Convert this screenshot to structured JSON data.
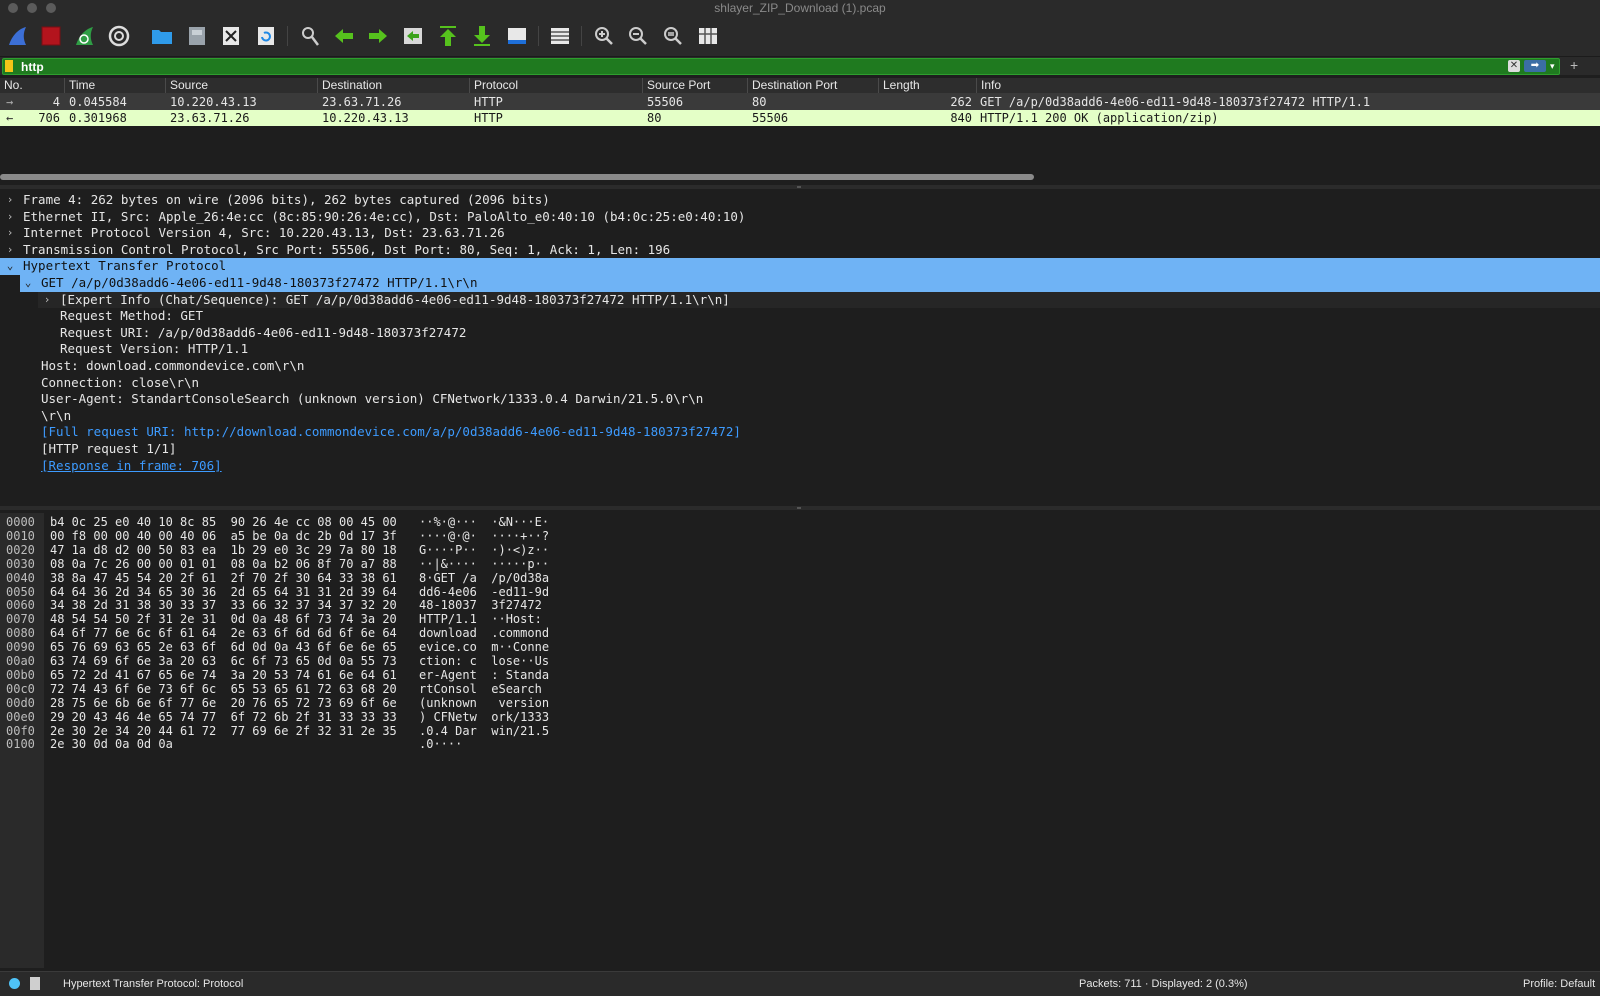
{
  "window": {
    "title": "shlayer_ZIP_Download (1).pcap"
  },
  "toolbar": {
    "buttons": [
      {
        "name": "start-capture",
        "icon": "shark-fin-icon"
      },
      {
        "name": "stop-capture",
        "icon": "stop-icon"
      },
      {
        "name": "restart-capture",
        "icon": "restart-fin-icon"
      },
      {
        "name": "capture-options",
        "icon": "gear-icon"
      },
      {
        "name": "open-file",
        "icon": "folder-icon"
      },
      {
        "name": "save-file",
        "icon": "save-icon"
      },
      {
        "name": "close-file",
        "icon": "close-file-icon"
      },
      {
        "name": "reload-file",
        "icon": "reload-icon"
      },
      {
        "name": "find-packet",
        "icon": "magnifier-icon"
      },
      {
        "name": "go-back",
        "icon": "arrow-left-icon"
      },
      {
        "name": "go-forward",
        "icon": "arrow-right-icon"
      },
      {
        "name": "go-to-packet",
        "icon": "go-to-icon"
      },
      {
        "name": "first-packet",
        "icon": "arrow-top-icon"
      },
      {
        "name": "last-packet",
        "icon": "arrow-bottom-icon"
      },
      {
        "name": "autoscroll",
        "icon": "autoscroll-icon"
      },
      {
        "name": "colorize",
        "icon": "colorize-icon"
      },
      {
        "name": "zoom-in",
        "icon": "zoom-in-icon"
      },
      {
        "name": "zoom-out",
        "icon": "zoom-out-icon"
      },
      {
        "name": "zoom-normal",
        "icon": "zoom-normal-icon"
      },
      {
        "name": "resize-columns",
        "icon": "resize-columns-icon"
      }
    ]
  },
  "filter": {
    "value": "http",
    "clear": "✕",
    "apply": "➡",
    "dropdown": "▾",
    "add": "+"
  },
  "packet_list": {
    "columns": [
      "No.",
      "Time",
      "Source",
      "Destination",
      "Protocol",
      "Source Port",
      "Destination Port",
      "Length",
      "Info"
    ],
    "rows": [
      {
        "marker": "→",
        "no": "4",
        "time": "0.045584",
        "source": "10.220.43.13",
        "destination": "23.63.71.26",
        "protocol": "HTTP",
        "src_port": "55506",
        "dst_port": "80",
        "length": "262",
        "info": "GET /a/p/0d38add6-4e06-ed11-9d48-180373f27472 HTTP/1.1"
      },
      {
        "marker": "←",
        "no": "706",
        "time": "0.301968",
        "source": "23.63.71.26",
        "destination": "10.220.43.13",
        "protocol": "HTTP",
        "src_port": "80",
        "dst_port": "55506",
        "length": "840",
        "info": "HTTP/1.1 200 OK  (application/zip)"
      }
    ]
  },
  "details": {
    "lines": [
      {
        "arrow": "›",
        "text": "Frame 4: 262 bytes on wire (2096 bits), 262 bytes captured (2096 bits)"
      },
      {
        "arrow": "›",
        "text": "Ethernet II, Src: Apple_26:4e:cc (8c:85:90:26:4e:cc), Dst: PaloAlto_e0:40:10 (b4:0c:25:e0:40:10)"
      },
      {
        "arrow": "›",
        "text": "Internet Protocol Version 4, Src: 10.220.43.13, Dst: 23.63.71.26"
      },
      {
        "arrow": "›",
        "text": "Transmission Control Protocol, Src Port: 55506, Dst Port: 80, Seq: 1, Ack: 1, Len: 196"
      },
      {
        "arrow": "⌄",
        "text": "Hypertext Transfer Protocol"
      },
      {
        "arrow": "⌄",
        "text": "GET /a/p/0d38add6-4e06-ed11-9d48-180373f27472 HTTP/1.1\\r\\n"
      },
      {
        "arrow": "›",
        "text": "[Expert Info (Chat/Sequence): GET /a/p/0d38add6-4e06-ed11-9d48-180373f27472 HTTP/1.1\\r\\n]"
      },
      {
        "arrow": "",
        "text": "Request Method: GET"
      },
      {
        "arrow": "",
        "text": "Request URI: /a/p/0d38add6-4e06-ed11-9d48-180373f27472"
      },
      {
        "arrow": "",
        "text": "Request Version: HTTP/1.1"
      },
      {
        "arrow": "",
        "text": "Host: download.commondevice.com\\r\\n"
      },
      {
        "arrow": "",
        "text": "Connection: close\\r\\n"
      },
      {
        "arrow": "",
        "text": "User-Agent: StandartConsoleSearch (unknown version) CFNetwork/1333.0.4 Darwin/21.5.0\\r\\n"
      },
      {
        "arrow": "",
        "text": "\\r\\n"
      },
      {
        "arrow": "",
        "text": "[Full request URI: http://download.commondevice.com/a/p/0d38add6-4e06-ed11-9d48-180373f27472]"
      },
      {
        "arrow": "",
        "text": "[HTTP request 1/1]"
      },
      {
        "arrow": "",
        "text": "[Response in frame: 706]"
      }
    ]
  },
  "bytes": {
    "rows": [
      {
        "off": "0000",
        "hex": "b4 0c 25 e0 40 10 8c 85  90 26 4e cc 08 00 45 00",
        "ascii": "··%·@···  ·&N···E·"
      },
      {
        "off": "0010",
        "hex": "00 f8 00 00 40 00 40 06  a5 be 0a dc 2b 0d 17 3f",
        "ascii": "····@·@·  ····+··?"
      },
      {
        "off": "0020",
        "hex": "47 1a d8 d2 00 50 83 ea  1b 29 e0 3c 29 7a 80 18",
        "ascii": "G····P··  ·)·<)z··"
      },
      {
        "off": "0030",
        "hex": "08 0a 7c 26 00 00 01 01  08 0a b2 06 8f 70 a7 88",
        "ascii": "··|&····  ·····p··"
      },
      {
        "off": "0040",
        "hex": "38 8a 47 45 54 20 2f 61  2f 70 2f 30 64 33 38 61",
        "ascii": "8·GET /a  /p/0d38a"
      },
      {
        "off": "0050",
        "hex": "64 64 36 2d 34 65 30 36  2d 65 64 31 31 2d 39 64",
        "ascii": "dd6-4e06  -ed11-9d"
      },
      {
        "off": "0060",
        "hex": "34 38 2d 31 38 30 33 37  33 66 32 37 34 37 32 20",
        "ascii": "48-18037  3f27472 "
      },
      {
        "off": "0070",
        "hex": "48 54 54 50 2f 31 2e 31  0d 0a 48 6f 73 74 3a 20",
        "ascii": "HTTP/1.1  ··Host: "
      },
      {
        "off": "0080",
        "hex": "64 6f 77 6e 6c 6f 61 64  2e 63 6f 6d 6d 6f 6e 64",
        "ascii": "download  .commond"
      },
      {
        "off": "0090",
        "hex": "65 76 69 63 65 2e 63 6f  6d 0d 0a 43 6f 6e 6e 65",
        "ascii": "evice.co  m··Conne"
      },
      {
        "off": "00a0",
        "hex": "63 74 69 6f 6e 3a 20 63  6c 6f 73 65 0d 0a 55 73",
        "ascii": "ction: c  lose··Us"
      },
      {
        "off": "00b0",
        "hex": "65 72 2d 41 67 65 6e 74  3a 20 53 74 61 6e 64 61",
        "ascii": "er-Agent  : Standa"
      },
      {
        "off": "00c0",
        "hex": "72 74 43 6f 6e 73 6f 6c  65 53 65 61 72 63 68 20",
        "ascii": "rtConsol  eSearch "
      },
      {
        "off": "00d0",
        "hex": "28 75 6e 6b 6e 6f 77 6e  20 76 65 72 73 69 6f 6e",
        "ascii": "(unknown   version"
      },
      {
        "off": "00e0",
        "hex": "29 20 43 46 4e 65 74 77  6f 72 6b 2f 31 33 33 33",
        "ascii": ") CFNetw  ork/1333"
      },
      {
        "off": "00f0",
        "hex": "2e 30 2e 34 20 44 61 72  77 69 6e 2f 32 31 2e 35",
        "ascii": ".0.4 Dar  win/21.5"
      },
      {
        "off": "0100",
        "hex": "2e 30 0d 0a 0d 0a",
        "ascii": ".0····"
      }
    ]
  },
  "status": {
    "field": "Hypertext Transfer Protocol: Protocol",
    "packets": "Packets: 711 · Displayed: 2 (0.3%)",
    "profile": "Profile: Default"
  },
  "colors": {
    "filter_valid": "#1f7a1f",
    "selected_row": "#3a3a3a",
    "response_row": "#e4ffc7",
    "selected_detail": "#6fb3f5",
    "link": "#3d9bff"
  }
}
